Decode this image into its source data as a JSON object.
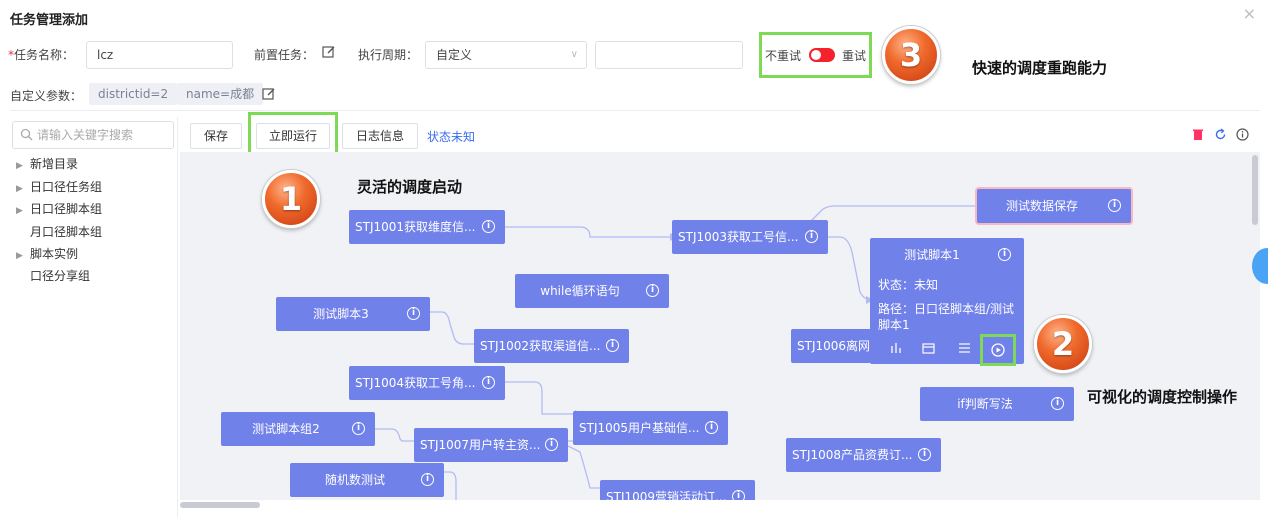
{
  "dialog": {
    "title": "任务管理添加",
    "close": "×"
  },
  "form": {
    "task_name_label": "任务名称：",
    "task_name_required": "*",
    "task_name_value": "lcz",
    "pre_task_label": "前置任务：",
    "cycle_label": "执行周期：",
    "cycle_value": "自定义",
    "cycle_arrow": "∨",
    "extra_value": "",
    "retry_off_label": "不重试",
    "retry_on_label": "重试",
    "custom_params_label": "自定义参数：",
    "params": [
      "districtid=2",
      "name=成都"
    ]
  },
  "callouts": {
    "badge1": "1",
    "badge2": "2",
    "badge3": "3",
    "text1": "灵活的调度启动",
    "text2": "可视化的调度控制操作",
    "text3": "快速的调度重跑能力"
  },
  "toolbar": {
    "save": "保存",
    "run_now": "立即运行",
    "log_info": "日志信息",
    "status": "状态未知"
  },
  "search": {
    "placeholder": "请输入关键字搜索"
  },
  "tree": {
    "items": [
      {
        "label": "新增目录",
        "expandable": true
      },
      {
        "label": "日口径任务组",
        "expandable": true
      },
      {
        "label": "日口径脚本组",
        "expandable": true
      },
      {
        "label": "月口径脚本组",
        "expandable": false
      },
      {
        "label": "脚本实例",
        "expandable": true
      },
      {
        "label": "口径分享组",
        "expandable": false
      }
    ]
  },
  "nodes": {
    "stj1001": "STJ1001获取维度信...",
    "stj1003": "STJ1003获取工号信...",
    "save_data": "测试数据保存",
    "while_loop": "while循环语句",
    "script3": "测试脚本3",
    "stj1002": "STJ1002获取渠道信...",
    "stj1006": "STJ1006离网用",
    "stj1004": "STJ1004获取工号角...",
    "if_judge": "if判断写法",
    "script_group2": "测试脚本组2",
    "stj1007": "STJ1007用户转主资...",
    "stj1005": "STJ1005用户基础信...",
    "stj1008": "STJ1008产品资费订...",
    "random_test": "随机数测试",
    "stj1009": "STJ1009营销活动订..."
  },
  "popup": {
    "title": "测试脚本1",
    "status": "状态：未知",
    "path_line1": "路径：日口径脚本组/测试",
    "path_line2": "脚本1"
  },
  "colors": {
    "node": "#7181ea",
    "canvas": "#f0f2f6",
    "highlight": "#7ed957",
    "toggle": "#f5222d",
    "accent": "#3a6df0"
  }
}
